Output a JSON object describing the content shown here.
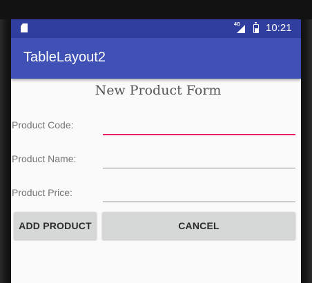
{
  "status_bar": {
    "time": "10:21",
    "network_type": "4G",
    "icons": [
      "sd-card-icon",
      "signal-icon",
      "battery-icon"
    ]
  },
  "app_bar": {
    "title": "TableLayout2",
    "color": "#3f51b5",
    "status_color": "#303f9f"
  },
  "form": {
    "title": "New Product Form",
    "fields": [
      {
        "label": "Product Code:",
        "value": "",
        "focused": true
      },
      {
        "label": "Product Name:",
        "value": ""
      },
      {
        "label": "Product Price:",
        "value": ""
      }
    ],
    "accent_color": "#e91e63",
    "buttons": {
      "add": "ADD PRODUCT",
      "cancel": "CANCEL"
    }
  }
}
